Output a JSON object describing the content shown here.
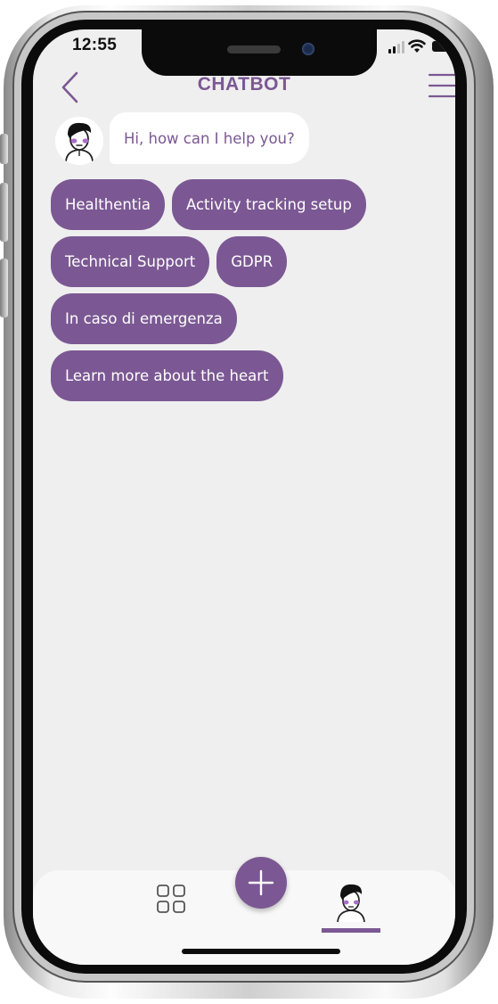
{
  "status_bar": {
    "time": "12:55",
    "icons": [
      "signal-icon",
      "wifi-icon",
      "battery-icon"
    ]
  },
  "header": {
    "title": "CHATBOT",
    "back_icon": "chevron-left-icon",
    "menu_icon": "hamburger-menu-icon"
  },
  "chat": {
    "bot_avatar_icon": "bot-avatar-icon",
    "greeting": "Hi, how can I help you?",
    "options": [
      "Healthentia",
      "Activity tracking setup",
      "Technical Support",
      "GDPR",
      "In caso di emergenza",
      "Learn more about the heart"
    ]
  },
  "bottom_nav": {
    "items": [
      {
        "icon": "grid-icon",
        "active": false
      },
      {
        "icon": "plus-icon",
        "active": false
      },
      {
        "icon": "chatbot-avatar-icon",
        "active": true
      }
    ]
  },
  "colors": {
    "accent": "#7b5893",
    "screen_background": "#efefef",
    "bubble_background": "#ffffff",
    "chip_text": "#ffffff",
    "nav_background": "#f8f8f8"
  }
}
